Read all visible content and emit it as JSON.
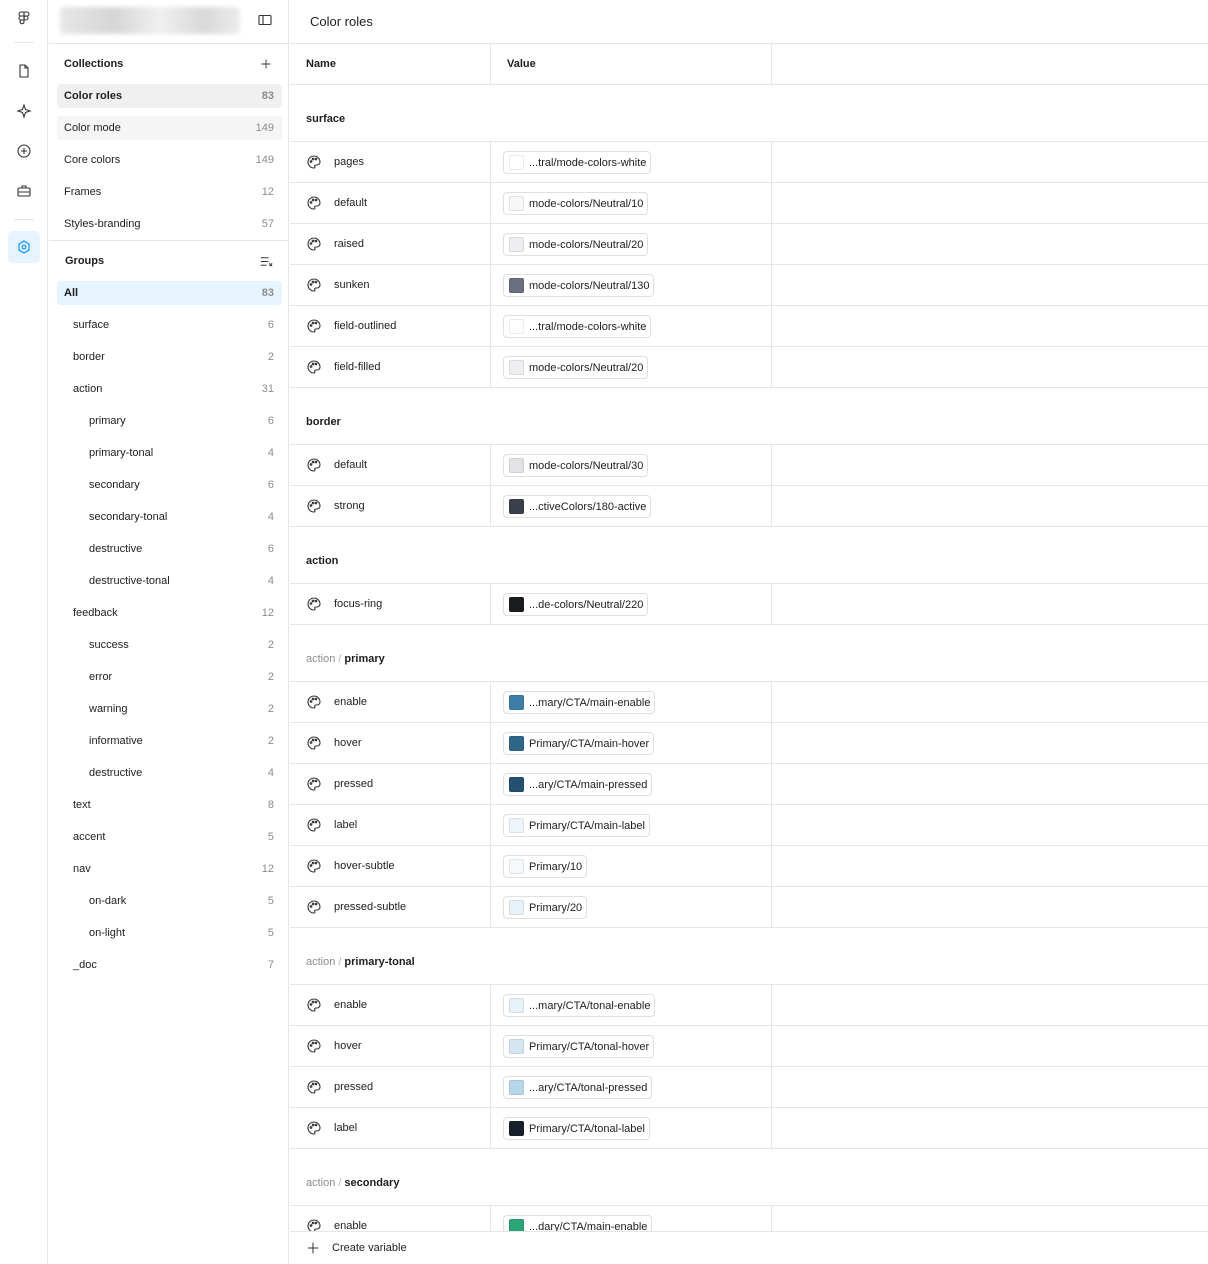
{
  "main": {
    "title": "Color roles",
    "col_name": "Name",
    "col_value": "Value",
    "create": "Create variable"
  },
  "collections": {
    "heading": "Collections",
    "items": [
      {
        "label": "Color roles",
        "count": "83"
      },
      {
        "label": "Color mode",
        "count": "149"
      },
      {
        "label": "Core colors",
        "count": "149"
      },
      {
        "label": "Frames",
        "count": "12"
      },
      {
        "label": "Styles-branding",
        "count": "57"
      }
    ]
  },
  "groups": {
    "heading": "Groups",
    "items": [
      {
        "label": "All",
        "count": "83",
        "level": 0
      },
      {
        "label": "surface",
        "count": "6",
        "level": 1
      },
      {
        "label": "border",
        "count": "2",
        "level": 1
      },
      {
        "label": "action",
        "count": "31",
        "level": 1
      },
      {
        "label": "primary",
        "count": "6",
        "level": 2
      },
      {
        "label": "primary-tonal",
        "count": "4",
        "level": 2
      },
      {
        "label": "secondary",
        "count": "6",
        "level": 2
      },
      {
        "label": "secondary-tonal",
        "count": "4",
        "level": 2
      },
      {
        "label": "destructive",
        "count": "6",
        "level": 2
      },
      {
        "label": "destructive-tonal",
        "count": "4",
        "level": 2
      },
      {
        "label": "feedback",
        "count": "12",
        "level": 1
      },
      {
        "label": "success",
        "count": "2",
        "level": 2
      },
      {
        "label": "error",
        "count": "2",
        "level": 2
      },
      {
        "label": "warning",
        "count": "2",
        "level": 2
      },
      {
        "label": "informative",
        "count": "2",
        "level": 2
      },
      {
        "label": "destructive",
        "count": "4",
        "level": 2
      },
      {
        "label": "text",
        "count": "8",
        "level": 1
      },
      {
        "label": "accent",
        "count": "5",
        "level": 1
      },
      {
        "label": "nav",
        "count": "12",
        "level": 1
      },
      {
        "label": "on-dark",
        "count": "5",
        "level": 2
      },
      {
        "label": "on-light",
        "count": "5",
        "level": 2
      },
      {
        "label": "_doc",
        "count": "7",
        "level": 1
      }
    ]
  },
  "variable_groups": [
    {
      "parent": "",
      "sep": "",
      "name": "surface",
      "rows": [
        {
          "name": "pages",
          "value": "...tral/mode-colors-white",
          "color": "#ffffff"
        },
        {
          "name": "default",
          "value": "mode-colors/Neutral/10",
          "color": "#f7f7f8"
        },
        {
          "name": "raised",
          "value": "mode-colors/Neutral/20",
          "color": "#eeeef0"
        },
        {
          "name": "sunken",
          "value": "mode-colors/Neutral/130",
          "color": "#6b7080"
        },
        {
          "name": "field-outlined",
          "value": "...tral/mode-colors-white",
          "color": "#ffffff"
        },
        {
          "name": "field-filled",
          "value": "mode-colors/Neutral/20",
          "color": "#eeeef0"
        }
      ]
    },
    {
      "parent": "",
      "sep": "",
      "name": "border",
      "rows": [
        {
          "name": "default",
          "value": "mode-colors/Neutral/30",
          "color": "#e3e3e6"
        },
        {
          "name": "strong",
          "value": "...ctiveColors/180-active",
          "color": "#3a3f4b"
        }
      ]
    },
    {
      "parent": "",
      "sep": "",
      "name": "action",
      "rows": [
        {
          "name": "focus-ring",
          "value": "...de-colors/Neutral/220",
          "color": "#1b1c20"
        }
      ]
    },
    {
      "parent": "action",
      "sep": "/",
      "name": "primary",
      "rows": [
        {
          "name": "enable",
          "value": "...mary/CTA/main-enable",
          "color": "#3d7ea6"
        },
        {
          "name": "hover",
          "value": "Primary/CTA/main-hover",
          "color": "#2e6689"
        },
        {
          "name": "pressed",
          "value": "...ary/CTA/main-pressed",
          "color": "#245170"
        },
        {
          "name": "label",
          "value": "Primary/CTA/main-label",
          "color": "#eef5fa"
        },
        {
          "name": "hover-subtle",
          "value": "Primary/10",
          "color": "#f5f9fc"
        },
        {
          "name": "pressed-subtle",
          "value": "Primary/20",
          "color": "#e7f1f8"
        }
      ]
    },
    {
      "parent": "action",
      "sep": "/",
      "name": "primary-tonal",
      "rows": [
        {
          "name": "enable",
          "value": "...mary/CTA/tonal-enable",
          "color": "#e7f1f8"
        },
        {
          "name": "hover",
          "value": "Primary/CTA/tonal-hover",
          "color": "#d4e6f2"
        },
        {
          "name": "pressed",
          "value": "...ary/CTA/tonal-pressed",
          "color": "#b8d6ea"
        },
        {
          "name": "label",
          "value": "Primary/CTA/tonal-label",
          "color": "#16202b"
        }
      ]
    },
    {
      "parent": "action",
      "sep": "/",
      "name": "secondary",
      "rows": [
        {
          "name": "enable",
          "value": "...dary/CTA/main-enable",
          "color": "#2aa676"
        }
      ]
    }
  ]
}
